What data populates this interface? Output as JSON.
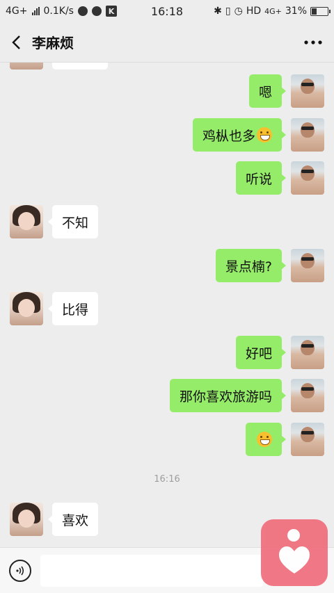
{
  "status_bar": {
    "network": "4G+",
    "speed": "0.1K/s",
    "time": "16:18",
    "hd": "HD",
    "network2": "4G+",
    "battery": "31%",
    "battery_level": 0.31
  },
  "header": {
    "back_icon": "chevron-left-icon",
    "title": "李麻烦",
    "more_icon": "more-dots-icon"
  },
  "messages": [
    {
      "sender": "me",
      "text": "嗯"
    },
    {
      "sender": "me",
      "text": "鸡枞也多",
      "emoji": "grin-emoji"
    },
    {
      "sender": "me",
      "text": "听说"
    },
    {
      "sender": "her",
      "text": "不知"
    },
    {
      "sender": "me",
      "text": "景点楠?"
    },
    {
      "sender": "her",
      "text": "比得"
    },
    {
      "sender": "me",
      "text": "好吧"
    },
    {
      "sender": "me",
      "text": "那你喜欢旅游吗"
    },
    {
      "sender": "me",
      "text": "",
      "emoji": "grin-emoji"
    },
    {
      "sender": "her",
      "text": "喜欢"
    }
  ],
  "timestamp": "16:16",
  "input_bar": {
    "voice_icon": "voice-icon",
    "placeholder": ""
  },
  "floating_app": {
    "icon": "heart-app-icon",
    "color": "#f06d7c"
  },
  "colors": {
    "my_bubble": "#95ec69",
    "her_bubble": "#ffffff",
    "background": "#ededed"
  }
}
